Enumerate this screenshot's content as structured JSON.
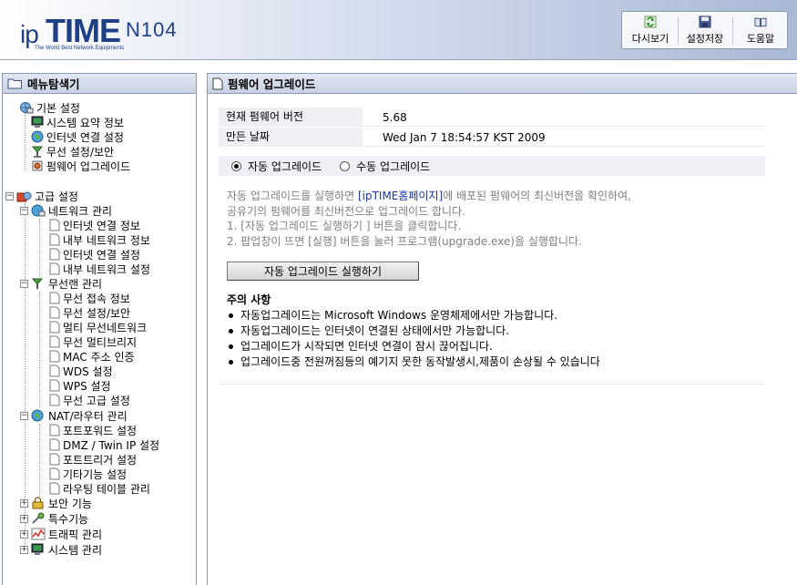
{
  "header": {
    "logo_ip": "ip",
    "logo_time": "TIME",
    "logo_tag": "The World Best Network Equipments",
    "model": "N104",
    "toolbar": {
      "reload_label": "다시보기",
      "save_label": "설정저장",
      "help_label": "도움말"
    }
  },
  "sidebar": {
    "title": "메뉴탐색기",
    "basic": {
      "label": "기본 설정",
      "items": [
        "시스템 요약 정보",
        "인터넷 연결 설정",
        "무선 설정/보안",
        "펌웨어 업그레이드"
      ]
    },
    "advanced": {
      "label": "고급 설정",
      "network": {
        "label": "네트워크 관리",
        "items": [
          "인터넷 연결 정보",
          "내부 네트워크 정보",
          "인터넷 연결 설정",
          "내부 네트워크 설정"
        ]
      },
      "wireless": {
        "label": "무선랜 관리",
        "items": [
          "무선 접속 정보",
          "무선 설정/보안",
          "멀티 무선네트워크",
          "무선 멀티브리지",
          "MAC 주소 인증",
          "WDS 설정",
          "WPS 설정",
          "무선 고급 설정"
        ]
      },
      "nat": {
        "label": "NAT/라우터 관리",
        "items": [
          "포트포워드 설정",
          "DMZ / Twin IP 설정",
          "포트트리거 설정",
          "기타기능 설정",
          "라우팅 테이블 관리"
        ]
      },
      "security": "보안 기능",
      "special": "특수기능",
      "traffic": "트래픽 관리",
      "system": "시스템 관리"
    }
  },
  "main": {
    "title": "펌웨어 업그레이드",
    "current_version_label": "현재 펌웨어 버전",
    "current_version_value": "5.68",
    "build_date_label": "만든 날짜",
    "build_date_value": "Wed Jan 7 18:54:57 KST 2009",
    "radio_auto": "자동 업그레이드",
    "radio_manual": "수동 업그레이드",
    "selected_mode": "auto",
    "desc": {
      "line1_pre": "자동 업그레이드를 실행하면 ",
      "line1_link": "[ipTIME홈페이지]",
      "line1_post": "에 배포된 펌웨어의 최신버전을 확인하여,",
      "line2": "공유기의 펌웨어를 최신버전으로 업그레이드 합니다.",
      "line3": "1. [자동 업그레이드 실행하기 ] 버튼을 클릭합니다.",
      "line4": "2. 팝업창이 뜨면 [실행] 버튼을 눌러 프로그램(upgrade.exe)을 실행합니다."
    },
    "run_button": "자동 업그레이드 실행하기",
    "notes_title": "주의 사항",
    "notes": [
      "자동업그레이드는 Microsoft Windows 운영체제에서만 가능합니다.",
      "자동업그레이드는 인터넷이 연결된 상태에서만 가능합니다.",
      "업그레이드가 시작되면 인터넷 연결이 잠시 끊어집니다.",
      "업그레이드중 전원꺼짐등의 예기지 못한 동작발생시,제품이 손상될 수 있습니다"
    ]
  }
}
